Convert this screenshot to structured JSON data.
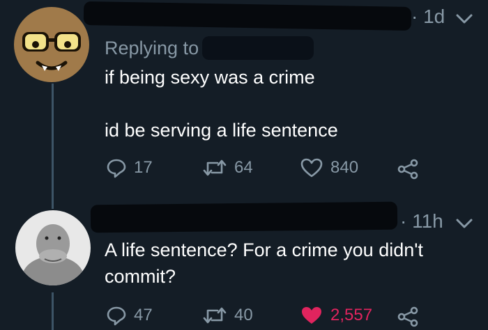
{
  "tweet1": {
    "time": "· 1d",
    "replying_to": "Replying to",
    "line1": "if being sexy was a crime",
    "line2": "id be serving a life sentence",
    "replies": "17",
    "retweets": "64",
    "likes": "840"
  },
  "tweet2": {
    "time": "· 11h",
    "text": "A life sentence? For a crime you didn't commit?",
    "replies": "47",
    "retweets": "40",
    "likes": "2,557",
    "liked": true
  },
  "colors": {
    "background": "#141d26",
    "muted": "#8899a6",
    "like_active": "#e0245e",
    "thread_line": "#3d5466"
  },
  "icons": [
    "reply-icon",
    "retweet-icon",
    "heart-icon",
    "share-icon",
    "chevron-down-icon"
  ]
}
